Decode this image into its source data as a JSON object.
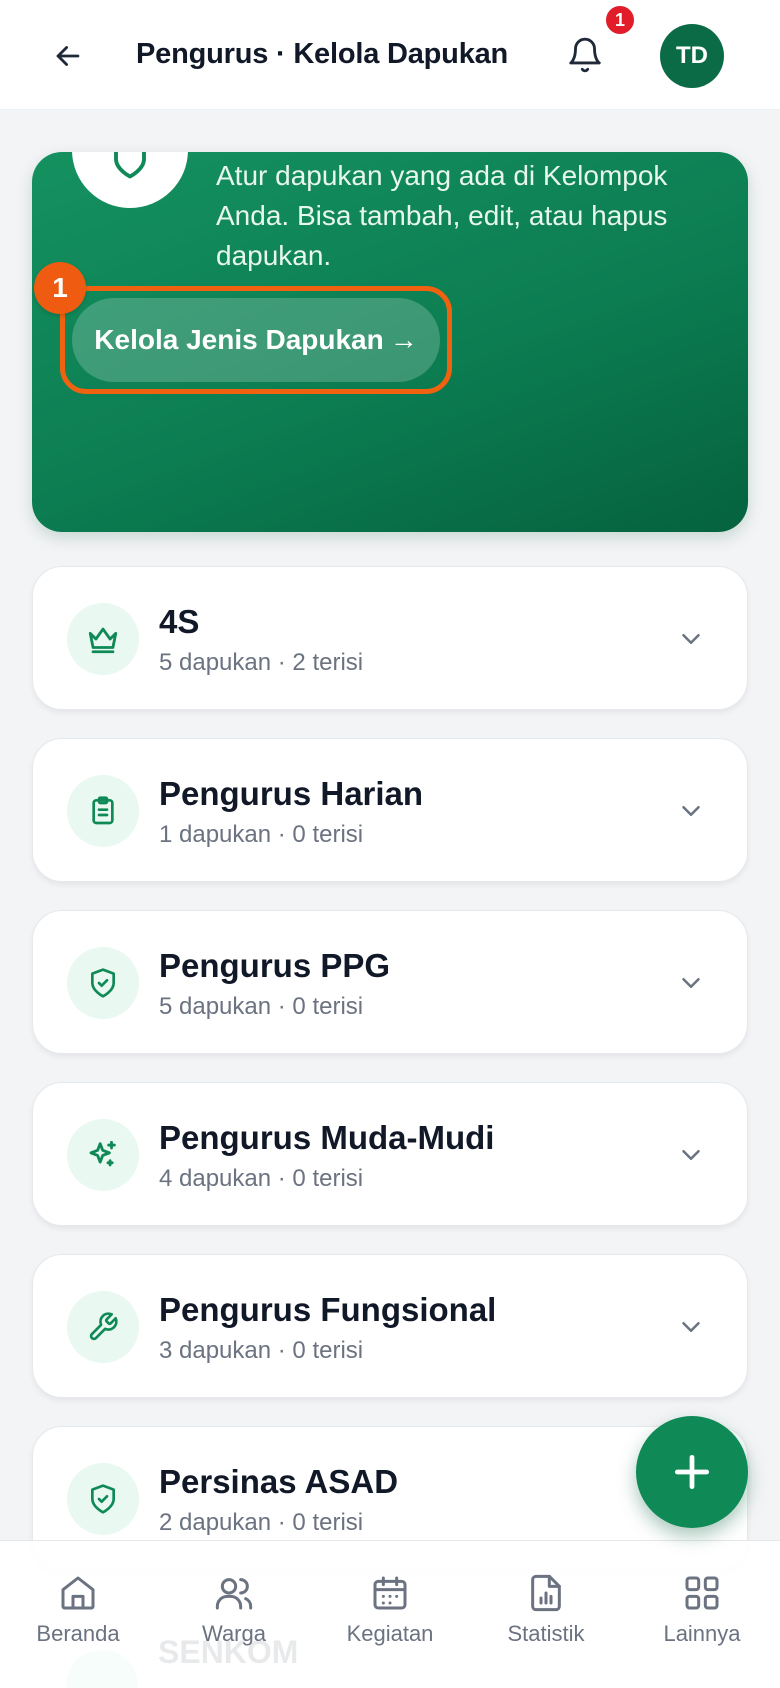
{
  "header": {
    "title": "Pengurus · Kelola Dapukan",
    "notification_count": "1",
    "avatar_initials": "TD"
  },
  "hero": {
    "description": "Atur dapukan yang ada di Kelompok Anda. Bisa tambah, edit, atau hapus dapukan.",
    "cta_label": "Kelola Jenis Dapukan",
    "cta_arrow": "→",
    "step_number": "1"
  },
  "groups": [
    {
      "name": "4S",
      "meta": "5 dapukan · 2 terisi",
      "icon": "crown-icon"
    },
    {
      "name": "Pengurus Harian",
      "meta": "1 dapukan · 0 terisi",
      "icon": "clipboard-icon"
    },
    {
      "name": "Pengurus PPG",
      "meta": "5 dapukan · 0 terisi",
      "icon": "shield-check-icon"
    },
    {
      "name": "Pengurus Muda-Mudi",
      "meta": "4 dapukan · 0 terisi",
      "icon": "sparkles-icon"
    },
    {
      "name": "Pengurus Fungsional",
      "meta": "3 dapukan · 0 terisi",
      "icon": "wrench-icon"
    },
    {
      "name": "Persinas ASAD",
      "meta": "2 dapukan · 0 terisi",
      "icon": "shield-check-icon"
    },
    {
      "name": "SENKOM",
      "icon": "shield-check-icon"
    }
  ],
  "bottom_nav": [
    {
      "label": "Beranda",
      "icon": "home-icon"
    },
    {
      "label": "Warga",
      "icon": "users-icon"
    },
    {
      "label": "Kegiatan",
      "icon": "calendar-icon"
    },
    {
      "label": "Statistik",
      "icon": "chart-icon"
    },
    {
      "label": "Lainnya",
      "icon": "grid-icon"
    }
  ],
  "colors": {
    "brand_green": "#0f8a57",
    "highlight_orange": "#ef5c11",
    "badge_red": "#e11d2a"
  }
}
